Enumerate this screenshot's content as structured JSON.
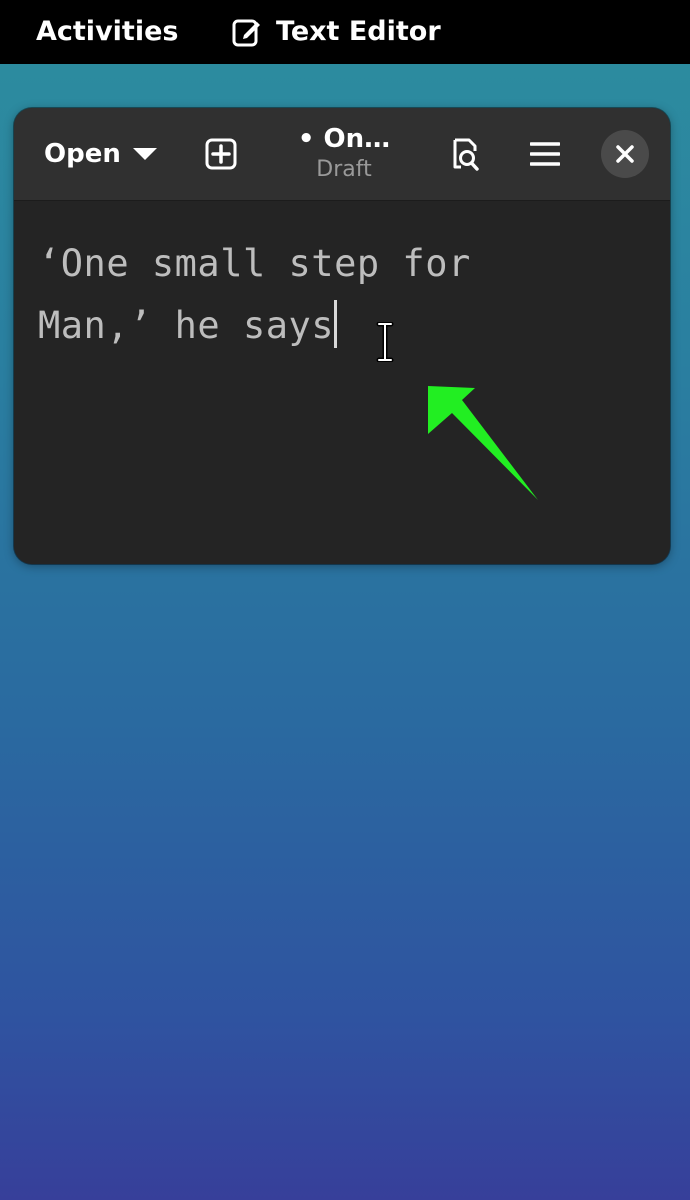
{
  "topbar": {
    "activities_label": "Activities",
    "app_name": "Text Editor",
    "app_icon": "text-editor-icon"
  },
  "window": {
    "open_label": "Open",
    "title": "• On…",
    "subtitle": "Draft",
    "buttons": {
      "new_tab_icon": "plus-square-icon",
      "search_icon": "document-search-icon",
      "menu_icon": "hamburger-menu-icon",
      "close_icon": "close-icon"
    }
  },
  "editor": {
    "line1": "‘One small step for",
    "line2": "Man,’ he says"
  },
  "colors": {
    "annotation_arrow": "#22ee22",
    "window_bg": "#242424",
    "headerbar_bg": "#303030"
  }
}
